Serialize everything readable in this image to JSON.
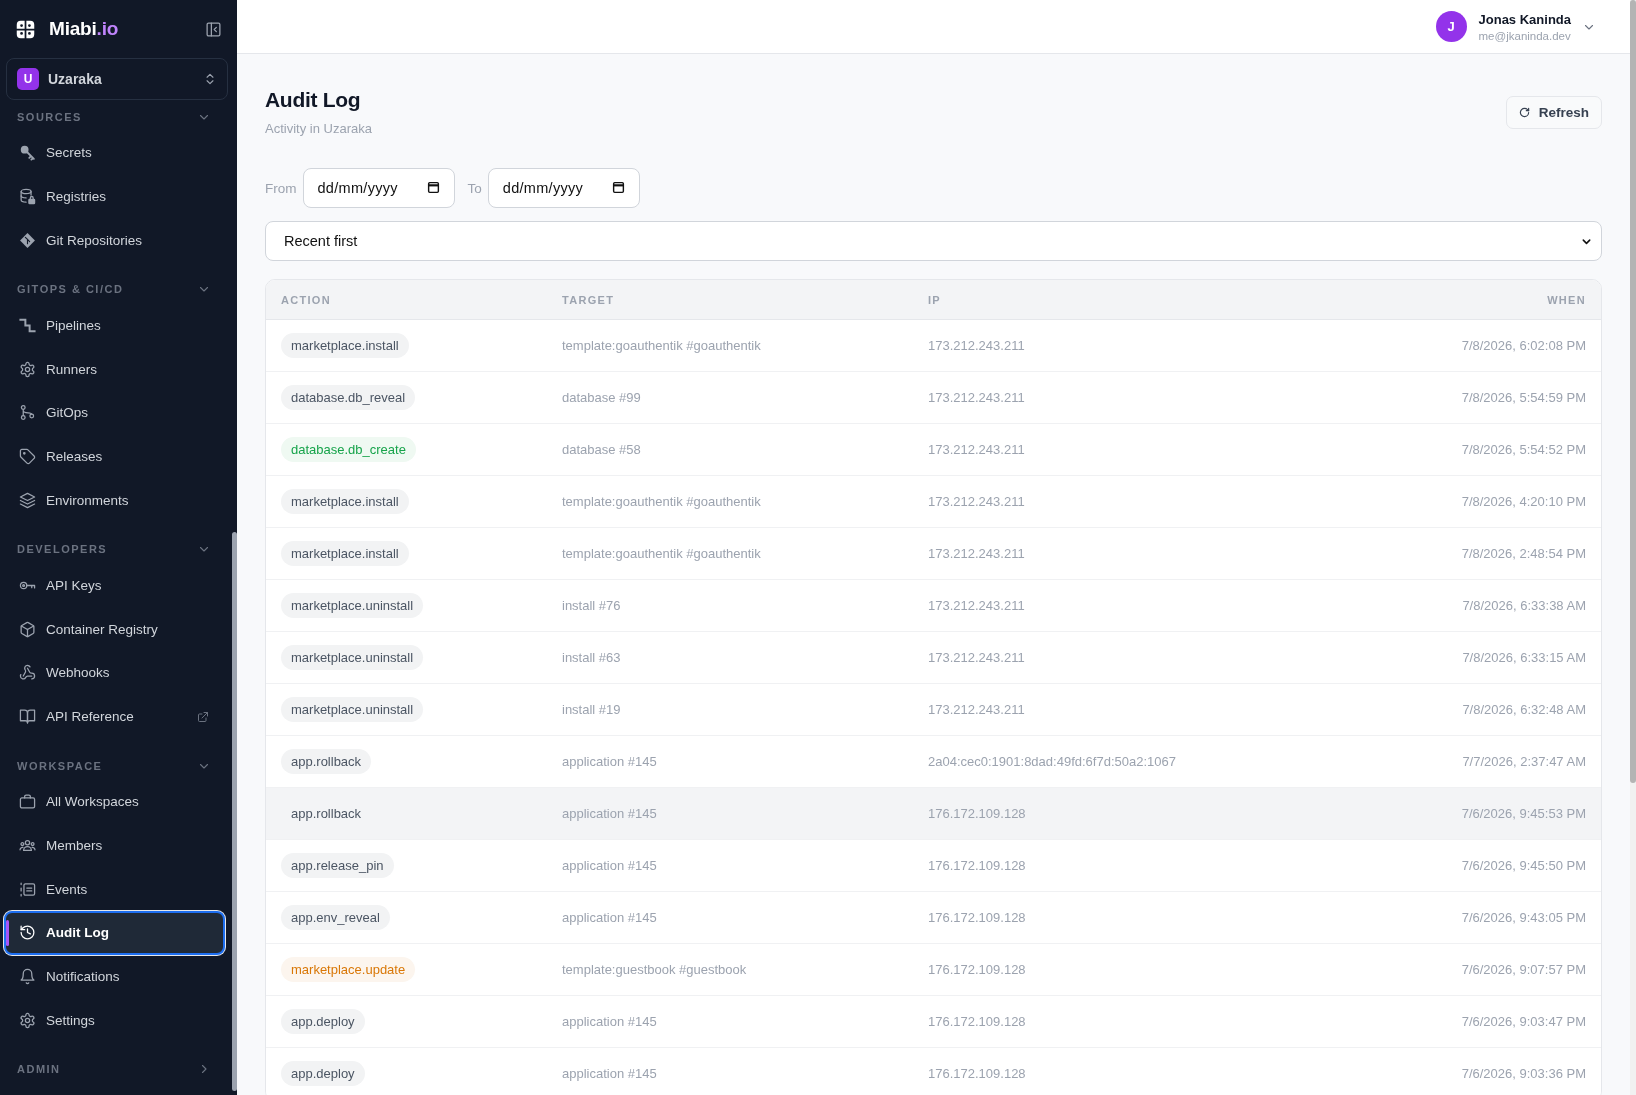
{
  "sidebar": {
    "brand": {
      "name": "Miabi",
      "suffix": ".io"
    },
    "workspace": {
      "initial": "U",
      "name": "Uzaraka"
    },
    "sections": [
      {
        "title": "SOURCES",
        "expanded": true,
        "items": [
          {
            "label": "Secrets",
            "selected": false
          },
          {
            "label": "Registries",
            "selected": false
          },
          {
            "label": "Git Repositories",
            "selected": false
          }
        ]
      },
      {
        "title": "GITOPS & CI/CD",
        "expanded": true,
        "items": [
          {
            "label": "Pipelines",
            "selected": false
          },
          {
            "label": "Runners",
            "selected": false
          },
          {
            "label": "GitOps",
            "selected": false
          },
          {
            "label": "Releases",
            "selected": false
          },
          {
            "label": "Environments",
            "selected": false
          }
        ]
      },
      {
        "title": "DEVELOPERS",
        "expanded": true,
        "items": [
          {
            "label": "API Keys",
            "selected": false,
            "external": false
          },
          {
            "label": "Container Registry",
            "selected": false,
            "external": false
          },
          {
            "label": "Webhooks",
            "selected": false,
            "external": false
          },
          {
            "label": "API Reference",
            "selected": false,
            "external": true
          }
        ]
      },
      {
        "title": "WORKSPACE",
        "expanded": true,
        "items": [
          {
            "label": "All Workspaces",
            "selected": false
          },
          {
            "label": "Members",
            "selected": false
          },
          {
            "label": "Events",
            "selected": false
          },
          {
            "label": "Audit Log",
            "selected": true
          },
          {
            "label": "Notifications",
            "selected": false
          },
          {
            "label": "Settings",
            "selected": false
          }
        ]
      },
      {
        "title": "ADMIN",
        "expanded": false
      }
    ]
  },
  "user": {
    "initial": "J",
    "name": "Jonas Kaninda",
    "email": "me@jkaninda.dev"
  },
  "page": {
    "title": "Audit Log",
    "subtitle": "Activity in Uzaraka",
    "refresh_button": "Refresh"
  },
  "filters": {
    "from": {
      "label": "From",
      "placeholder": "dd/mm/yyyy"
    },
    "to": {
      "label": "To",
      "placeholder": "dd/mm/yyyy"
    },
    "sort": {
      "value": "Recent first"
    }
  },
  "table": {
    "columns": [
      "ACTION",
      "TARGET",
      "IP",
      "WHEN"
    ],
    "rows": [
      {
        "action": "marketplace.install",
        "color": "#4b5563",
        "target": "template:goauthentik #goauthentik",
        "ip": "173.212.243.211",
        "when": "7/8/2026, 6:02:08 PM",
        "highlighted": false
      },
      {
        "action": "database.db_reveal",
        "color": "#4b5563",
        "target": "database #99",
        "ip": "173.212.243.211",
        "when": "7/8/2026, 5:54:59 PM",
        "highlighted": false
      },
      {
        "action": "database.db_create",
        "color": "#16a34a",
        "target": "database #58",
        "ip": "173.212.243.211",
        "when": "7/8/2026, 5:54:52 PM",
        "highlighted": false
      },
      {
        "action": "marketplace.install",
        "color": "#4b5563",
        "target": "template:goauthentik #goauthentik",
        "ip": "173.212.243.211",
        "when": "7/8/2026, 4:20:10 PM",
        "highlighted": false
      },
      {
        "action": "marketplace.install",
        "color": "#4b5563",
        "target": "template:goauthentik #goauthentik",
        "ip": "173.212.243.211",
        "when": "7/8/2026, 2:48:54 PM",
        "highlighted": false
      },
      {
        "action": "marketplace.uninstall",
        "color": "#4b5563",
        "target": "install #76",
        "ip": "173.212.243.211",
        "when": "7/8/2026, 6:33:38 AM",
        "highlighted": false
      },
      {
        "action": "marketplace.uninstall",
        "color": "#4b5563",
        "target": "install #63",
        "ip": "173.212.243.211",
        "when": "7/8/2026, 6:33:15 AM",
        "highlighted": false
      },
      {
        "action": "marketplace.uninstall",
        "color": "#4b5563",
        "target": "install #19",
        "ip": "173.212.243.211",
        "when": "7/8/2026, 6:32:48 AM",
        "highlighted": false
      },
      {
        "action": "app.rollback",
        "color": "#4b5563",
        "target": "application #145",
        "ip": "2a04:cec0:1901:8dad:49fd:6f7d:50a2:1067",
        "when": "7/7/2026, 2:37:47 AM",
        "highlighted": false
      },
      {
        "action": "app.rollback",
        "color": "#4b5563",
        "target": "application #145",
        "ip": "176.172.109.128",
        "when": "7/6/2026, 9:45:53 PM",
        "highlighted": true
      },
      {
        "action": "app.release_pin",
        "color": "#4b5563",
        "target": "application #145",
        "ip": "176.172.109.128",
        "when": "7/6/2026, 9:45:50 PM",
        "highlighted": false
      },
      {
        "action": "app.env_reveal",
        "color": "#4b5563",
        "target": "application #145",
        "ip": "176.172.109.128",
        "when": "7/6/2026, 9:43:05 PM",
        "highlighted": false
      },
      {
        "action": "marketplace.update",
        "color": "#d97706",
        "target": "template:guestbook #guestbook",
        "ip": "176.172.109.128",
        "when": "7/6/2026, 9:07:57 PM",
        "highlighted": false
      },
      {
        "action": "app.deploy",
        "color": "#4b5563",
        "target": "application #145",
        "ip": "176.172.109.128",
        "when": "7/6/2026, 9:03:47 PM",
        "highlighted": false
      },
      {
        "action": "app.deploy",
        "color": "#4b5563",
        "target": "application #145",
        "ip": "176.172.109.128",
        "when": "7/6/2026, 9:03:36 PM",
        "highlighted": false
      }
    ]
  }
}
